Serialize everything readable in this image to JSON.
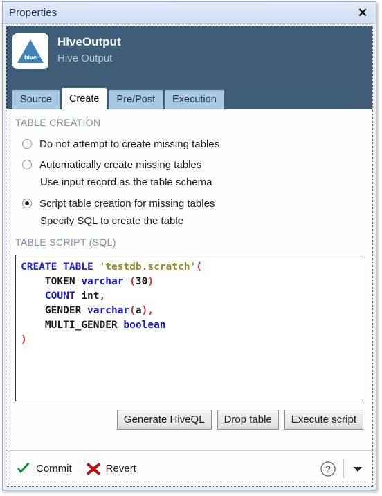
{
  "window": {
    "title": "Properties",
    "close_label": "✕"
  },
  "node": {
    "name": "HiveOutput",
    "subtitle": "Hive Output",
    "icon": "hive-logo-icon",
    "icon_text": "hive"
  },
  "tabs": [
    {
      "label": "Source",
      "active": false
    },
    {
      "label": "Create",
      "active": true
    },
    {
      "label": "Pre/Post",
      "active": false
    },
    {
      "label": "Execution",
      "active": false
    }
  ],
  "table_creation": {
    "section_label": "TABLE CREATION",
    "options": [
      {
        "label": "Do not attempt to create missing tables",
        "checked": false,
        "sub_label": ""
      },
      {
        "label": "Automatically create missing tables",
        "checked": false,
        "sub_label": "Use input record as the table schema"
      },
      {
        "label": "Script table creation for missing tables",
        "checked": true,
        "sub_label": "Specify SQL to create the table"
      }
    ]
  },
  "table_script": {
    "section_label": "TABLE SCRIPT (SQL)",
    "code_plain": "CREATE TABLE 'testdb.scratch'(\n    TOKEN varchar (30)\n    COUNT int,\n    GENDER varchar(a),\n    MULTI_GENDER boolean\n)",
    "lines": [
      [
        {
          "t": "CREATE",
          "c": "k"
        },
        {
          "t": " ",
          "c": ""
        },
        {
          "t": "TABLE",
          "c": "k"
        },
        {
          "t": " ",
          "c": ""
        },
        {
          "t": "'testdb.scratch'",
          "c": "str"
        },
        {
          "t": "(",
          "c": "pn"
        }
      ],
      [
        {
          "t": "    ",
          "c": ""
        },
        {
          "t": "TOKEN",
          "c": "id"
        },
        {
          "t": " ",
          "c": ""
        },
        {
          "t": "varchar",
          "c": "kw2"
        },
        {
          "t": " ",
          "c": ""
        },
        {
          "t": "(",
          "c": "pn"
        },
        {
          "t": "30",
          "c": "num"
        },
        {
          "t": ")",
          "c": "pn"
        }
      ],
      [
        {
          "t": "    ",
          "c": ""
        },
        {
          "t": "COUNT",
          "c": "kw2"
        },
        {
          "t": " ",
          "c": ""
        },
        {
          "t": "int",
          "c": "id"
        },
        {
          "t": ",",
          "c": "pn"
        }
      ],
      [
        {
          "t": "    ",
          "c": ""
        },
        {
          "t": "GENDER",
          "c": "id"
        },
        {
          "t": " ",
          "c": ""
        },
        {
          "t": "varchar",
          "c": "kw2"
        },
        {
          "t": "(",
          "c": "pn"
        },
        {
          "t": "a",
          "c": "num"
        },
        {
          "t": ")",
          "c": "pn"
        },
        {
          "t": ",",
          "c": "pn"
        }
      ],
      [
        {
          "t": "    ",
          "c": ""
        },
        {
          "t": "MULTI_GENDER",
          "c": "id"
        },
        {
          "t": " ",
          "c": ""
        },
        {
          "t": "boolean",
          "c": "kw2"
        }
      ],
      [
        {
          "t": ")",
          "c": "pn"
        }
      ]
    ]
  },
  "actions": [
    {
      "label": "Generate HiveQL"
    },
    {
      "label": "Drop table"
    },
    {
      "label": "Execute script"
    }
  ],
  "footer": {
    "commit_label": "Commit",
    "revert_label": "Revert",
    "commit_icon": "green-check-icon",
    "revert_icon": "red-x-icon",
    "help_icon": "question-mark-circle-icon",
    "caret_icon": "caret-down-icon"
  },
  "colors": {
    "header_bg": "#3f5d76",
    "titlebar_bg": "#dce6f8",
    "tab_inactive": "#a7c8e0",
    "tab_active": "#fdfdfd",
    "section_label": "#7d90a6",
    "commit_green": "#0e8a29",
    "revert_red": "#c20f0f",
    "sql_keyword": "#2222dd",
    "sql_string": "#9a8b22",
    "sql_punct": "#d02a2a"
  }
}
